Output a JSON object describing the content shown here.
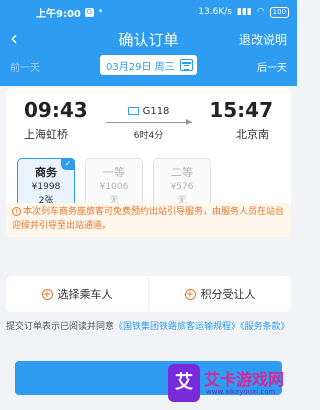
{
  "status_bar": {
    "time": "上午9:00",
    "net": "13.6K/s",
    "battery": "100"
  },
  "header": {
    "back_icon": "chevron-left-icon",
    "title": "确认订单",
    "action": "退改说明"
  },
  "date_bar": {
    "prev": "前一天",
    "date": "03月29日 周三",
    "next": "后一天"
  },
  "trip": {
    "depart_time": "09:43",
    "depart_station": "上海虹桥",
    "train_no": "G118",
    "duration": "6时4分",
    "arrive_time": "15:47",
    "arrive_station": "北京南"
  },
  "seats": [
    {
      "name": "商务",
      "price": "¥1998",
      "avail": "2张",
      "selected": true
    },
    {
      "name": "一等",
      "price": "¥1006",
      "avail": "无",
      "selected": false
    },
    {
      "name": "二等",
      "price": "¥576",
      "avail": "无",
      "selected": false
    }
  ],
  "notice": "本次列车商务座旅客可免费预约出站引导服务，由服务人员在站台迎候并引导至出站通道。",
  "actions": {
    "choose_passenger": "选择乘车人",
    "points_recipient": "积分受让人"
  },
  "agreement": {
    "text": "提交订单表示已阅读并同意",
    "link1": "《国铁集团铁路旅客运输规程》",
    "link2": "《服务条款》"
  },
  "watermark": {
    "logo": "艾",
    "text": "艾卡游戏网",
    "sub": "www.aikayouxi.com"
  },
  "colors": {
    "brand": "#2e9cf0",
    "notice": "#e8782f"
  }
}
